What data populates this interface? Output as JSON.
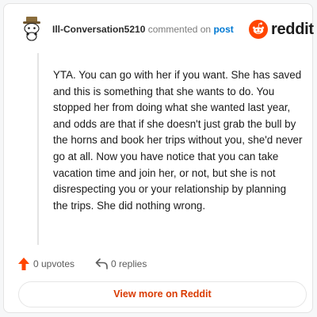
{
  "header": {
    "username": "Ill-Conversation5210",
    "commented_text": "commented on",
    "post_link": "post",
    "brand": "reddit"
  },
  "comment": {
    "body": "YTA. You can go with her if you want. She has saved and this is something that she wants to do. You stopped her from doing what she wanted last year, and odds are that if she doesn't just grab the bull by the horns and book her trips without you, she'd never go at all. Now you have notice that you can take vacation time and join her, or not, but she is not disrespecting you or your relationship by planning the trips. She did nothing wrong."
  },
  "actions": {
    "upvotes": "0 upvotes",
    "replies": "0 replies"
  },
  "footer": {
    "view_more": "View more on Reddit"
  },
  "colors": {
    "brand_orange": "#ff4500",
    "link_blue": "#0079d3",
    "button_text": "#d93a00"
  },
  "icons": {
    "avatar": "snoo-avatar-with-hat",
    "brand": "reddit-snoo-logo-icon",
    "upvote": "upvote-arrow-icon",
    "reply": "reply-arrow-icon"
  }
}
